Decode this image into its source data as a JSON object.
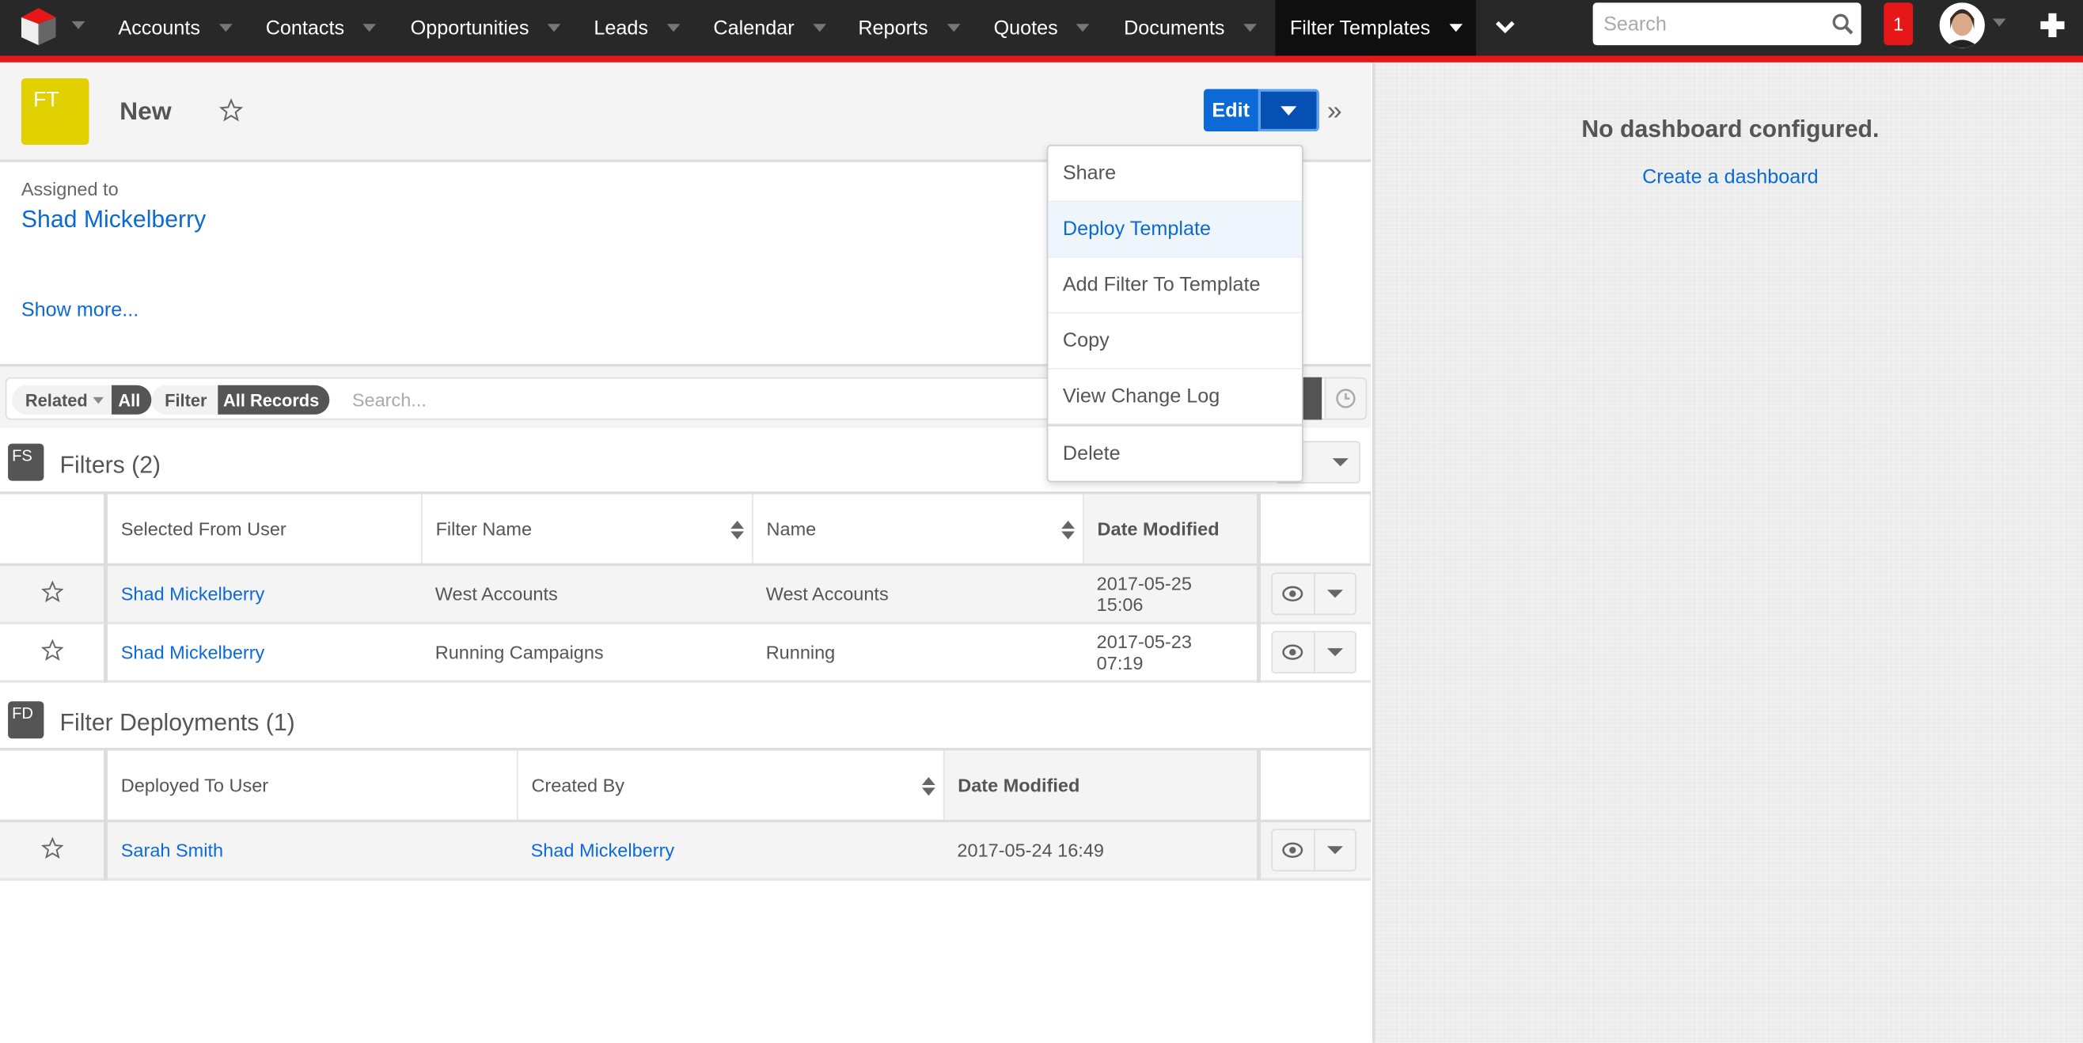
{
  "nav": {
    "items": [
      {
        "label": "Accounts"
      },
      {
        "label": "Contacts"
      },
      {
        "label": "Opportunities"
      },
      {
        "label": "Leads"
      },
      {
        "label": "Calendar"
      },
      {
        "label": "Reports"
      },
      {
        "label": "Quotes"
      },
      {
        "label": "Documents"
      },
      {
        "label": "Filter Templates",
        "active": true
      }
    ],
    "search_placeholder": "Search",
    "notification_count": "1",
    "colors": {
      "bar": "#282828",
      "accent": "#e61718"
    }
  },
  "record": {
    "module_badge": "FT",
    "module_color": "#e2d100",
    "title": "New",
    "edit_label": "Edit",
    "assigned_label": "Assigned to",
    "assigned_value": "Shad Mickelberry",
    "show_more": "Show more..."
  },
  "actions_menu": {
    "items": [
      "Share",
      "Deploy Template",
      "Add Filter To Template",
      "Copy",
      "View Change Log",
      "Delete"
    ],
    "highlighted": "Deploy Template"
  },
  "filterbar": {
    "related_label": "Related",
    "related_value": "All",
    "filter_label": "Filter",
    "filter_value": "All Records",
    "search_placeholder": "Search..."
  },
  "subpanels": [
    {
      "badge": "FS",
      "title": "Filters (2)",
      "columns": [
        "Selected From User",
        "Filter Name",
        "Name",
        "Date Modified"
      ],
      "rows": [
        [
          "Shad Mickelberry",
          "West Accounts",
          "West Accounts",
          "2017-05-25 15:06"
        ],
        [
          "Shad Mickelberry",
          "Running Campaigns",
          "Running",
          "2017-05-23 07:19"
        ]
      ]
    },
    {
      "badge": "FD",
      "title": "Filter Deployments (1)",
      "columns": [
        "Deployed To User",
        "Created By",
        "Date Modified"
      ],
      "rows": [
        [
          "Sarah Smith",
          "Shad Mickelberry",
          "2017-05-24 16:49"
        ]
      ]
    }
  ],
  "dashboard": {
    "message": "No dashboard configured.",
    "link": "Create a dashboard"
  }
}
